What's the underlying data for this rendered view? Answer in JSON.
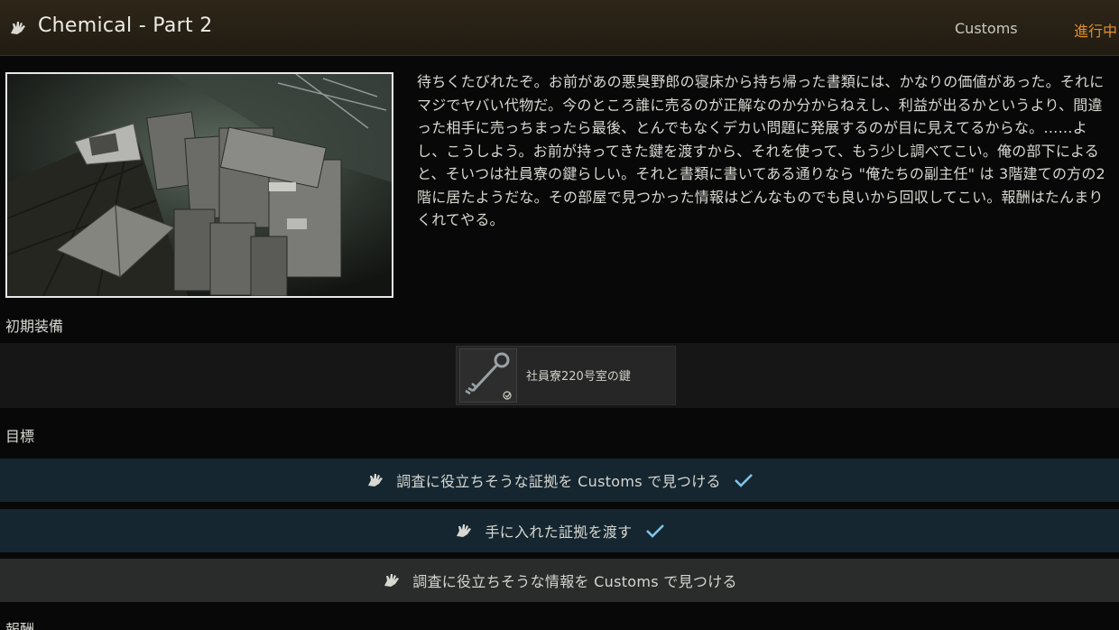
{
  "header": {
    "icon": "quest-hand-icon",
    "title": "Chemical - Part 2",
    "location": "Customs",
    "status": "進行中"
  },
  "image": {
    "description_icon": "quest-image"
  },
  "description": "待ちくたびれたぞ。お前があの悪臭野郎の寝床から持ち帰った書類には、かなりの価値があった。それにマジでヤバい代物だ。今のところ誰に売るのが正解なのか分からねえし、利益が出るかというより、間違った相手に売っちまったら最後、とんでもなくデカい問題に発展するのが目に見えてるからな。……よし、こうしよう。お前が持ってきた鍵を渡すから、それを使って、もう少し調べてこい。俺の部下によると、そいつは社員寮の鍵らしい。それと書類に書いてある通りなら \"俺たちの副主任\" は 3階建ての方の2階に居たようだな。その部屋で見つかった情報はどんなものでも良いから回収してこい。報酬はたんまりくれてやる。",
  "initial_equipment": {
    "label": "初期装備",
    "items": [
      {
        "name": "社員寮220号室の鍵",
        "icon": "key-icon"
      }
    ]
  },
  "objectives": {
    "label": "目標",
    "items": [
      {
        "text": "調査に役立ちそうな証拠を Customs で見つける",
        "completed": true
      },
      {
        "text": "手に入れた証拠を渡す",
        "completed": true
      },
      {
        "text": "調査に役立ちそうな情報を Customs で見つける",
        "completed": false
      }
    ]
  },
  "rewards": {
    "label": "報酬"
  },
  "colors": {
    "status": "#e0902c",
    "check": "#7fc4e8",
    "objective_done_bg": "#152630",
    "objective_pending_bg": "#2a2b2b"
  }
}
